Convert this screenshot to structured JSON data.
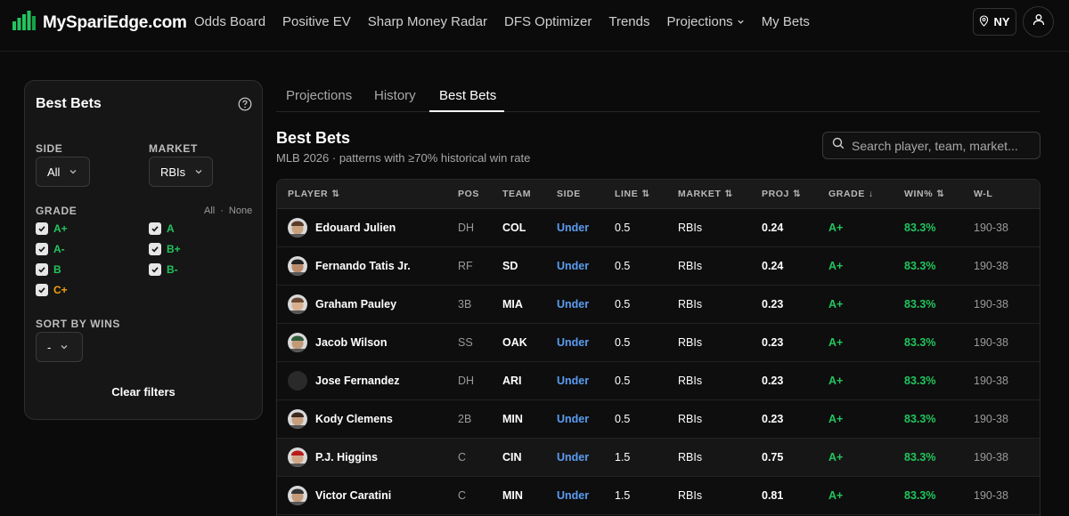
{
  "brand": {
    "name": "MySpariEdge.com",
    "logo_color": "#22c55e"
  },
  "nav": [
    {
      "label": "Odds Board"
    },
    {
      "label": "Positive EV"
    },
    {
      "label": "Sharp Money Radar"
    },
    {
      "label": "DFS Optimizer"
    },
    {
      "label": "Trends"
    },
    {
      "label": "Projections",
      "has_dropdown": true
    },
    {
      "label": "My Bets"
    }
  ],
  "location": {
    "label": "NY",
    "icon": "map-pin-icon"
  },
  "user": {
    "icon": "user-icon"
  },
  "filters": {
    "title": "Best Bets",
    "side": {
      "label": "SIDE",
      "value": "All"
    },
    "market": {
      "label": "MARKET",
      "value": "RBIs"
    },
    "grade": {
      "label": "GRADE",
      "all_link": "All",
      "separator": "·",
      "none_link": "None",
      "options": [
        {
          "label": "A+",
          "checked": true,
          "color": "#22c55e"
        },
        {
          "label": "A",
          "checked": true,
          "color": "#22c55e"
        },
        {
          "label": "A-",
          "checked": true,
          "color": "#22c55e"
        },
        {
          "label": "B+",
          "checked": true,
          "color": "#22c55e"
        },
        {
          "label": "B",
          "checked": true,
          "color": "#22c55e"
        },
        {
          "label": "B-",
          "checked": true,
          "color": "#22c55e"
        },
        {
          "label": "C+",
          "checked": true,
          "color": "#f59e0b"
        }
      ]
    },
    "sort_by_wins": {
      "label": "SORT BY WINS",
      "value": "-"
    },
    "clear": "Clear filters"
  },
  "tabs": [
    {
      "label": "Projections",
      "active": false
    },
    {
      "label": "History",
      "active": false
    },
    {
      "label": "Best Bets",
      "active": true
    }
  ],
  "section": {
    "title": "Best Bets",
    "subtitle": "MLB 2026 · patterns with ≥70% historical win rate"
  },
  "search": {
    "placeholder": "Search player, team, market..."
  },
  "table": {
    "columns": [
      {
        "label": "PLAYER",
        "sort": "both"
      },
      {
        "label": "POS"
      },
      {
        "label": "TEAM"
      },
      {
        "label": "SIDE"
      },
      {
        "label": "LINE",
        "sort": "both"
      },
      {
        "label": "MARKET",
        "sort": "both"
      },
      {
        "label": "PROJ",
        "sort": "both"
      },
      {
        "label": "GRADE",
        "sort": "desc"
      },
      {
        "label": "WIN%",
        "sort": "both"
      },
      {
        "label": "W-L"
      }
    ],
    "rows": [
      {
        "player": "Edouard Julien",
        "pos": "DH",
        "team": "COL",
        "side": "Under",
        "line": "0.5",
        "market": "RBIs",
        "proj": "0.24",
        "grade": "A+",
        "win": "83.3%",
        "wl": "190-38"
      },
      {
        "player": "Fernando Tatis Jr.",
        "pos": "RF",
        "team": "SD",
        "side": "Under",
        "line": "0.5",
        "market": "RBIs",
        "proj": "0.24",
        "grade": "A+",
        "win": "83.3%",
        "wl": "190-38"
      },
      {
        "player": "Graham Pauley",
        "pos": "3B",
        "team": "MIA",
        "side": "Under",
        "line": "0.5",
        "market": "RBIs",
        "proj": "0.23",
        "grade": "A+",
        "win": "83.3%",
        "wl": "190-38"
      },
      {
        "player": "Jacob Wilson",
        "pos": "SS",
        "team": "OAK",
        "side": "Under",
        "line": "0.5",
        "market": "RBIs",
        "proj": "0.23",
        "grade": "A+",
        "win": "83.3%",
        "wl": "190-38"
      },
      {
        "player": "Jose Fernandez",
        "pos": "DH",
        "team": "ARI",
        "side": "Under",
        "line": "0.5",
        "market": "RBIs",
        "proj": "0.23",
        "grade": "A+",
        "win": "83.3%",
        "wl": "190-38"
      },
      {
        "player": "Kody Clemens",
        "pos": "2B",
        "team": "MIN",
        "side": "Under",
        "line": "0.5",
        "market": "RBIs",
        "proj": "0.23",
        "grade": "A+",
        "win": "83.3%",
        "wl": "190-38"
      },
      {
        "player": "P.J. Higgins",
        "pos": "C",
        "team": "CIN",
        "side": "Under",
        "line": "1.5",
        "market": "RBIs",
        "proj": "0.75",
        "grade": "A+",
        "win": "83.3%",
        "wl": "190-38"
      },
      {
        "player": "Victor Caratini",
        "pos": "C",
        "team": "MIN",
        "side": "Under",
        "line": "1.5",
        "market": "RBIs",
        "proj": "0.81",
        "grade": "A+",
        "win": "83.3%",
        "wl": "190-38"
      }
    ]
  }
}
